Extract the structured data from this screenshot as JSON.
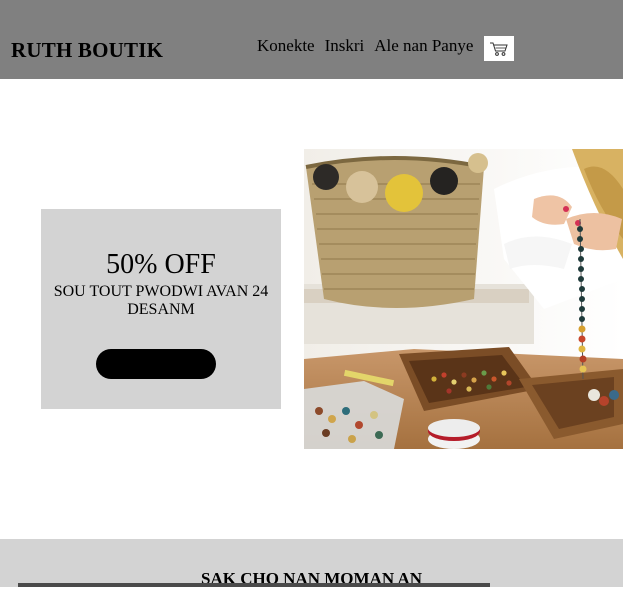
{
  "header": {
    "brand": "RUTH BOUTIK",
    "nav": [
      {
        "label": "Konekte"
      },
      {
        "label": "Inskri"
      },
      {
        "label": "Ale nan Panye"
      }
    ],
    "cart_icon": "shopping-cart-icon"
  },
  "promo": {
    "title": "50% OFF",
    "subtitle": "SOU TOUT PWODWI AVAN 24 DESANM",
    "button_label": ""
  },
  "hero": {
    "image_icon": "beadwork-photo"
  },
  "section2": {
    "title": "SAK CHO NAN MOMAN AN"
  },
  "colors": {
    "header_bg": "#808080",
    "promo_bg": "#d3d3d3",
    "button_bg": "#000000"
  }
}
